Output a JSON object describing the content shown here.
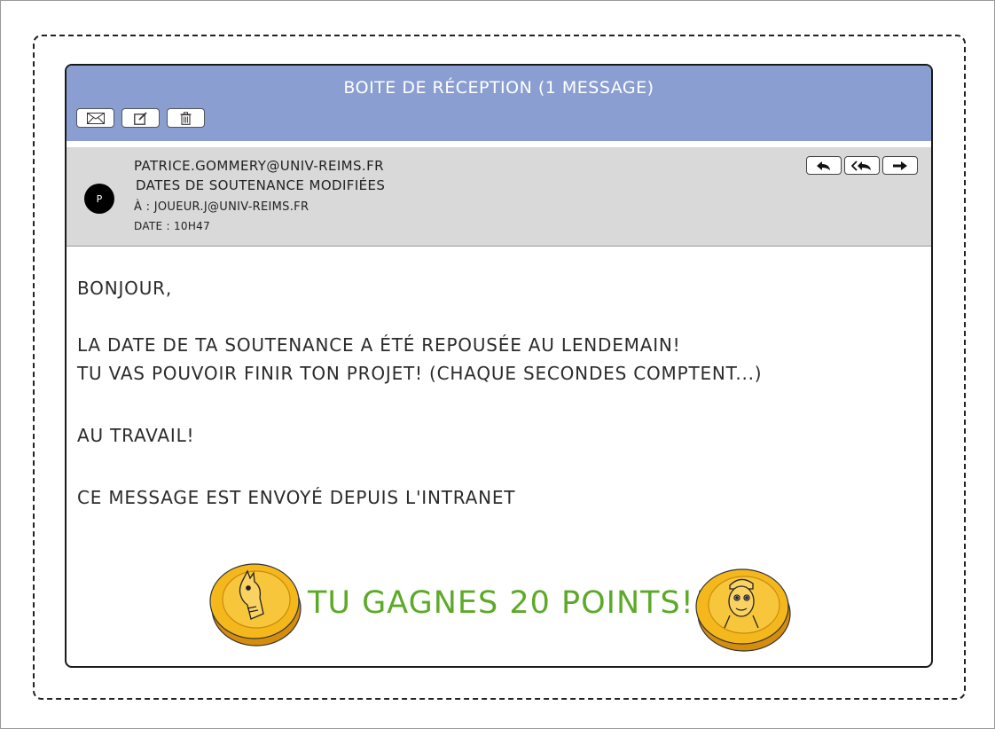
{
  "window": {
    "title": "Boite de réception  (1 message)"
  },
  "toolbar": {
    "buttons": [
      {
        "icon": "envelope-icon"
      },
      {
        "icon": "compose-icon"
      },
      {
        "icon": "trash-icon"
      }
    ]
  },
  "message": {
    "avatar_initial": "P",
    "from": "patrice.gommery@univ-reims.fr",
    "subject": "Dates de soutenance modifiées",
    "to": "À : joueur.j@univ-reims.fr",
    "date": "Date : 10h47",
    "actions": [
      {
        "icon": "reply-icon"
      },
      {
        "icon": "reply-all-icon"
      },
      {
        "icon": "forward-icon"
      }
    ]
  },
  "body": {
    "greeting": "Bonjour,",
    "line1": "La date de ta soutenance a été repousée au lendemain!",
    "line2": "Tu vas pouvoir finir ton projet! (Chaque secondes comptent...)",
    "line3": "Au travail!",
    "signature": "Ce message est envoyé depuis l'intranet"
  },
  "reward": {
    "text": "Tu gagnes 20 points!!",
    "color": "#5daa28",
    "coin_left_icon": "llama-coin-icon",
    "coin_right_icon": "face-coin-icon"
  },
  "colors": {
    "titlebar": "#8a9ed1",
    "header_panel": "#d9d9d9",
    "coin_gold": "#f5b81c"
  }
}
